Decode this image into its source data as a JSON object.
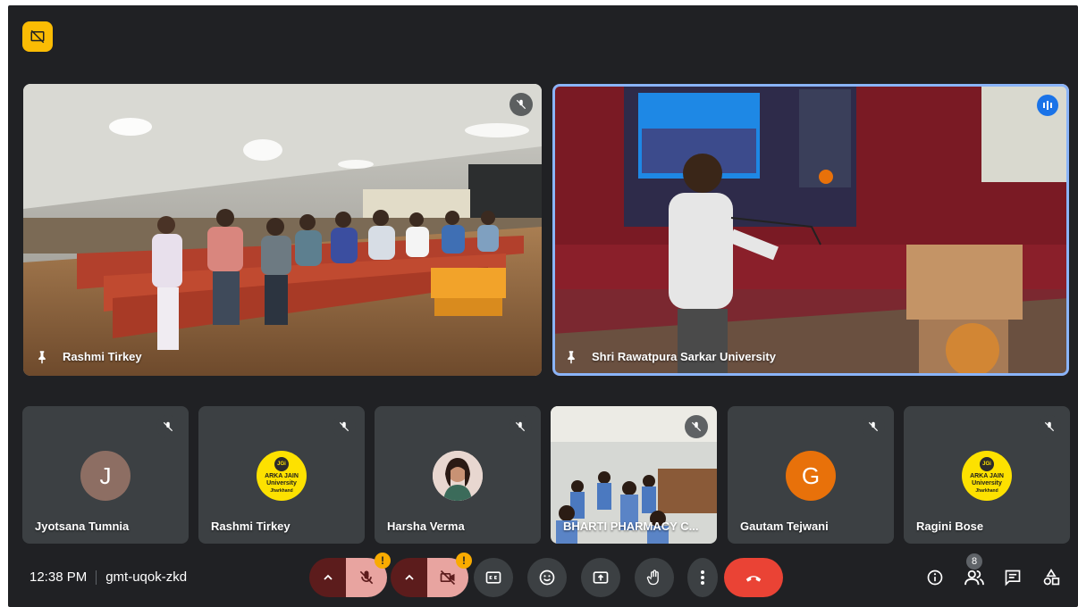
{
  "meeting": {
    "time": "12:38 PM",
    "code": "gmt-uqok-zkd"
  },
  "main_tiles": [
    {
      "name": "Rashmi Tirkey",
      "muted": true,
      "pinned": true
    },
    {
      "name": "Shri Rawatpura Sarkar University",
      "speaking": true,
      "pinned": true
    }
  ],
  "participants": [
    {
      "name": "Jyotsana Tumnia",
      "avatar_letter": "J",
      "avatar_color": "#8d6e63",
      "muted": true
    },
    {
      "name": "Rashmi Tirkey",
      "avatar": "arka-jain-logo",
      "muted": true
    },
    {
      "name": "Harsha Verma",
      "avatar": "photo",
      "muted": true
    },
    {
      "name": "BHARTI PHARMACY C...",
      "avatar": "video",
      "muted": true
    },
    {
      "name": "Gautam Tejwani",
      "avatar_letter": "G",
      "avatar_color": "#e8710a",
      "muted": true
    },
    {
      "name": "Ragini Bose",
      "avatar": "arka-jain-logo",
      "muted": true
    }
  ],
  "logo": {
    "top": "JGi",
    "line1": "ARKA JAIN",
    "line2": "University",
    "line3": "Jharkhand"
  },
  "people_count": "8",
  "warning_mark": "!",
  "colors": {
    "background": "#202124",
    "tile": "#3c4043",
    "accent": "#8ab4f8",
    "hangup": "#ea4335",
    "warning": "#f9ab00",
    "presenting": "#fbbc04"
  },
  "controls": [
    "mic-toggle",
    "camera-toggle",
    "captions",
    "emoji",
    "present",
    "raise-hand",
    "more-options",
    "leave-call"
  ],
  "right_controls": [
    "meeting-details",
    "people",
    "chat",
    "activities"
  ]
}
